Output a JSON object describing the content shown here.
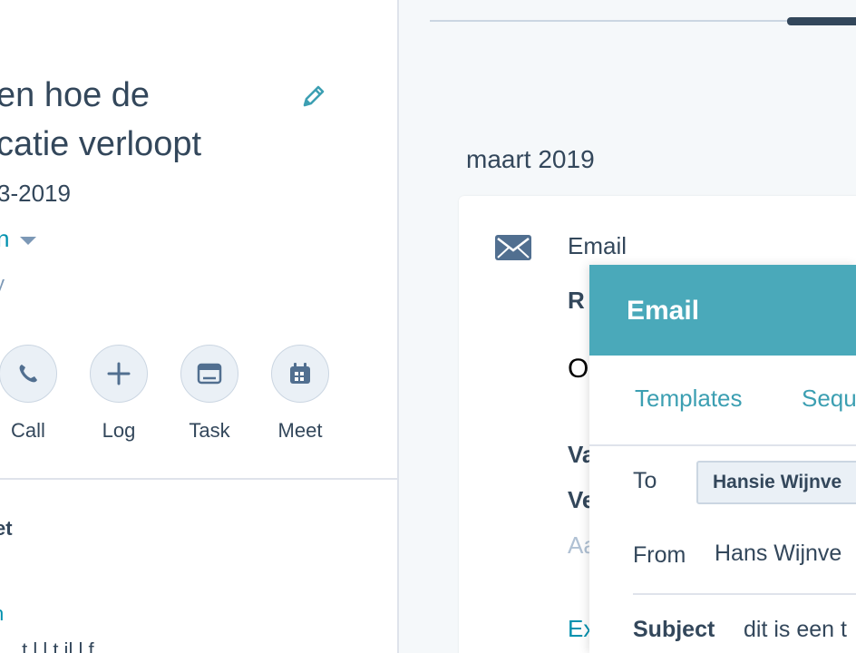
{
  "task": {
    "title_line1": "en hoe de",
    "title_line2": "catie verloopt",
    "due_date": "3-2019",
    "owner": "n",
    "queue_partial": "y"
  },
  "actions": [
    {
      "label": "Call",
      "icon": "phone-icon"
    },
    {
      "label": "Log",
      "icon": "plus-icon"
    },
    {
      "label": "Task",
      "icon": "task-icon"
    },
    {
      "label": "Meet",
      "icon": "calendar-icon"
    }
  ],
  "left_bottom": {
    "section_heading": "et",
    "link_fragment": "n",
    "text_fragment": "… t  l l        t  il   l     f"
  },
  "timeline": {
    "month": "maart 2019",
    "activity_type": "Email",
    "hidden_fragments": [
      "R",
      "O",
      "Va",
      "Ve",
      "Aa",
      "Ex"
    ]
  },
  "composer": {
    "title": "Email",
    "tabs": [
      "Templates",
      "Sequ"
    ],
    "to_label": "To",
    "to_value": "Hansie Wijnve",
    "from_label": "From",
    "from_value": "Hans Wijnve",
    "subject_label": "Subject",
    "subject_value": "dit is een t"
  },
  "colors": {
    "accent": "#0091ae",
    "composer_header": "#4aa9ba",
    "text": "#33475b",
    "icon_bg": "#eaf0f6"
  }
}
